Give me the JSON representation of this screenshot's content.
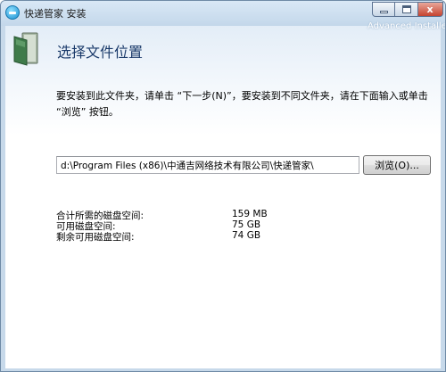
{
  "window": {
    "title": "快递管家 安装",
    "controls": {
      "minimize": "minimize",
      "maximize": "maximize",
      "close": "x"
    }
  },
  "header": {
    "brand_watermark": "Advanced Installer",
    "title": "选择文件位置",
    "icon": "folder-icon"
  },
  "instruction": "要安装到此文件夹，请单击 “下一步(N)”，要安装到不同文件夹，请在下面输入或单击 “浏览” 按钮。",
  "install_path": {
    "value": "d:\\Program Files (x86)\\中通吉网络技术有限公司\\快递管家\\"
  },
  "browse_label": "浏览(O)...",
  "disk_space": [
    {
      "label": "合计所需的磁盘空间:",
      "value": "159 MB"
    },
    {
      "label": "可用磁盘空间:",
      "value": "75 GB"
    },
    {
      "label": "剩余可用磁盘空间:",
      "value": "74 GB"
    }
  ],
  "colors": {
    "title_text": "#1a3a6a",
    "titlebar": "#c7d9ea",
    "close_button": "#c5432f"
  }
}
